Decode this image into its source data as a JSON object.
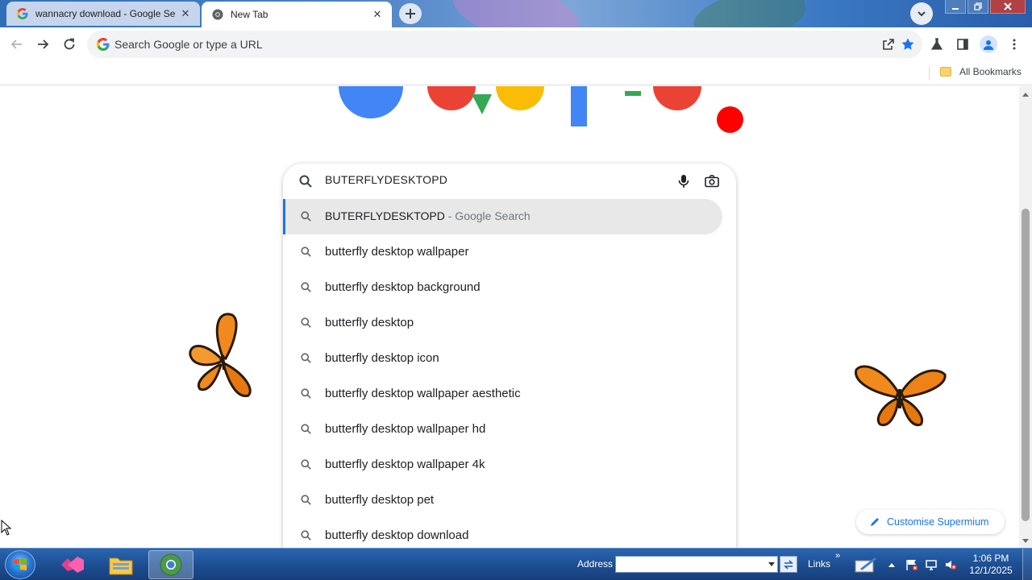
{
  "browser": {
    "tabs": [
      {
        "title": "wannacry download - Google Se",
        "active": false
      },
      {
        "title": "New Tab",
        "active": true
      }
    ],
    "omnibox": {
      "placeholder": "Search Google or type a URL"
    },
    "bookmarks": {
      "all_label": "All Bookmarks"
    }
  },
  "ntp": {
    "search": {
      "query": "BUTERFLYDESKTOPD",
      "selected": {
        "text": "BUTERFLYDESKTOPD",
        "suffix": " - Google Search"
      },
      "suggestions": [
        "butterfly desktop wallpaper",
        "butterfly desktop background",
        "butterfly desktop",
        "butterfly desktop icon",
        "butterfly desktop wallpaper aesthetic",
        "butterfly desktop wallpaper hd",
        "butterfly desktop wallpaper 4k",
        "butterfly desktop pet",
        "butterfly desktop download"
      ]
    },
    "customise_label": "Customise Supermium"
  },
  "taskbar": {
    "address_label": "Address",
    "links_label": "Links",
    "links_chevron": "»",
    "clock": {
      "time": "1:06 PM",
      "date": "12/1/2025"
    }
  },
  "colors": {
    "accent": "#1a73e8",
    "red_dot": "#ff0000",
    "taskbar": "#1d4f93"
  }
}
